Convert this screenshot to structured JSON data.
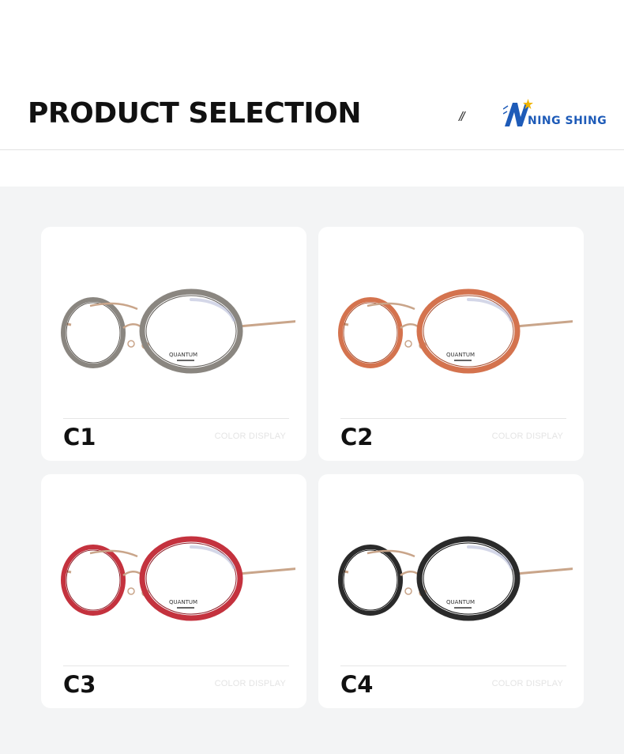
{
  "header": {
    "title": "PRODUCT SELECTION",
    "separator": "//",
    "brand_logo": "NING SHING",
    "brand_color": "#1e5bb8",
    "brand_star_color": "#f0b400"
  },
  "products": [
    {
      "code": "C1",
      "tag": "COLOR DISPLAY",
      "rim_color": "#8a8680",
      "rim_dark": "#5f5b56",
      "temple_tip": "#5a5a56"
    },
    {
      "code": "C2",
      "tag": "COLOR DISPLAY",
      "rim_color": "#d4734e",
      "rim_dark": "#a84f30",
      "temple_tip": "#c0604a"
    },
    {
      "code": "C3",
      "tag": "COLOR DISPLAY",
      "rim_color": "#c4323e",
      "rim_dark": "#8e1e28",
      "temple_tip": "#b02c38"
    },
    {
      "code": "C4",
      "tag": "COLOR DISPLAY",
      "rim_color": "#2a2a2a",
      "rim_dark": "#0f0f0f",
      "temple_tip": "#1d1d1d"
    }
  ]
}
